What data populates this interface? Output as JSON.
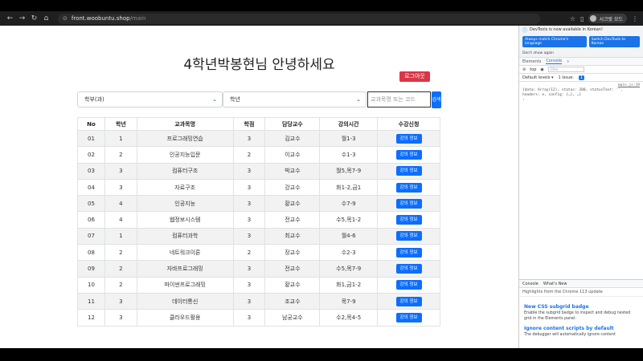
{
  "browser": {
    "url_host": "front.woobuntu.shop",
    "url_path": "/main",
    "profile_name": "시크릿 모드"
  },
  "page": {
    "title": "4학년박봉현님 안녕하세요",
    "logout_label": "로그아웃",
    "dept_select_value": "학부(과)",
    "grade_select_value": "학년",
    "search_placeholder": "교과목명 또는 코드",
    "search_label": "검색"
  },
  "table": {
    "headers": [
      "No",
      "학년",
      "교과목명",
      "학점",
      "담당교수",
      "강의시간",
      "수강신청"
    ],
    "button_label": "강의 정보",
    "rows": [
      [
        "01",
        "1",
        "프로그래밍연습",
        "3",
        "김교수",
        "월1-3"
      ],
      [
        "02",
        "2",
        "인공지능입문",
        "2",
        "이교수",
        "수1-3"
      ],
      [
        "03",
        "3",
        "컴퓨터구조",
        "3",
        "박교수",
        "월5,목7-9"
      ],
      [
        "04",
        "3",
        "자료구조",
        "3",
        "강교수",
        "화1-2,금1"
      ],
      [
        "05",
        "4",
        "인공지능",
        "3",
        "황교수",
        "수7-9"
      ],
      [
        "06",
        "4",
        "웹정보시스템",
        "3",
        "전교수",
        "수5,목1-2"
      ],
      [
        "07",
        "1",
        "컴퓨터과학",
        "3",
        "최교수",
        "월4-6"
      ],
      [
        "08",
        "2",
        "네트워크이론",
        "2",
        "장교수",
        "수2-3"
      ],
      [
        "09",
        "2",
        "자바프로그래밍",
        "3",
        "전교수",
        "수5,목7-9"
      ],
      [
        "10",
        "2",
        "파이썬프로그래밍",
        "3",
        "황교수",
        "화1,금1-2"
      ],
      [
        "11",
        "3",
        "데이터통신",
        "3",
        "조교수",
        "목7-9"
      ],
      [
        "12",
        "3",
        "클라우드활용",
        "3",
        "남궁교수",
        "수2,목4-5"
      ]
    ]
  },
  "devtools": {
    "notice": "DevTools is now available in Korean!",
    "btn_match": "Always match Chrome's language",
    "btn_switch": "Switch DevTools to Korean",
    "dont_show": "Don't show again",
    "tabs": [
      "Elements",
      "Console",
      "»"
    ],
    "context": "top",
    "filter_placeholder": "Filter",
    "levels": "Default levels ▾",
    "issues": "1 Issue:",
    "issue_count": "1",
    "log_src": "main.js:19",
    "log_text": "{data: Array(12), status: 200, statusText: '', headers: e, config: {…}, …}",
    "drawer_tabs": [
      "Console",
      "What's New"
    ],
    "drawer_sub": "Highlights from the Chrome 113 update",
    "h1": "New CSS subgrid badge",
    "p1": "Enable the subgrid badge to inspect and debug nested grid in the Elements panel.",
    "h2": "Ignore content scripts by default",
    "p2": "The debugger will automatically ignore content"
  }
}
